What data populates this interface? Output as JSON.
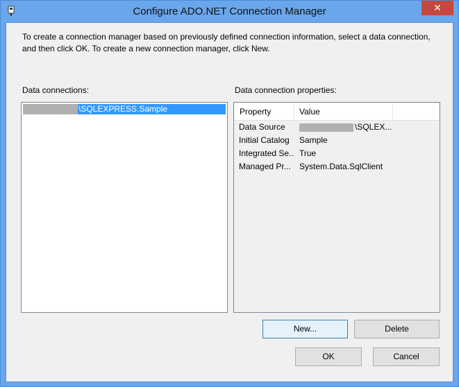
{
  "window": {
    "title": "Configure ADO.NET Connection Manager",
    "close_glyph": "✕"
  },
  "info_text": "To create a connection manager based on previously defined connection information, select a data connection, and then click OK. To create a new connection manager, click New.",
  "connections": {
    "label": "Data connections:",
    "items": [
      {
        "text": "\\SQLEXPRESS.Sample",
        "selected": true
      }
    ]
  },
  "properties": {
    "label": "Data connection properties:",
    "columns": [
      "Property",
      "Value"
    ],
    "rows": [
      {
        "name": "Data Source",
        "value": "\\SQLEX..."
      },
      {
        "name": "Initial Catalog",
        "value": "Sample"
      },
      {
        "name": "Integrated Se...",
        "value": "True"
      },
      {
        "name": "Managed Pr...",
        "value": "System.Data.SqlClient"
      }
    ]
  },
  "buttons": {
    "new": "New...",
    "delete": "Delete",
    "ok": "OK",
    "cancel": "Cancel"
  },
  "colors": {
    "titlebar": "#6aa6eb",
    "selection": "#3399ff",
    "close": "#c7463e"
  }
}
